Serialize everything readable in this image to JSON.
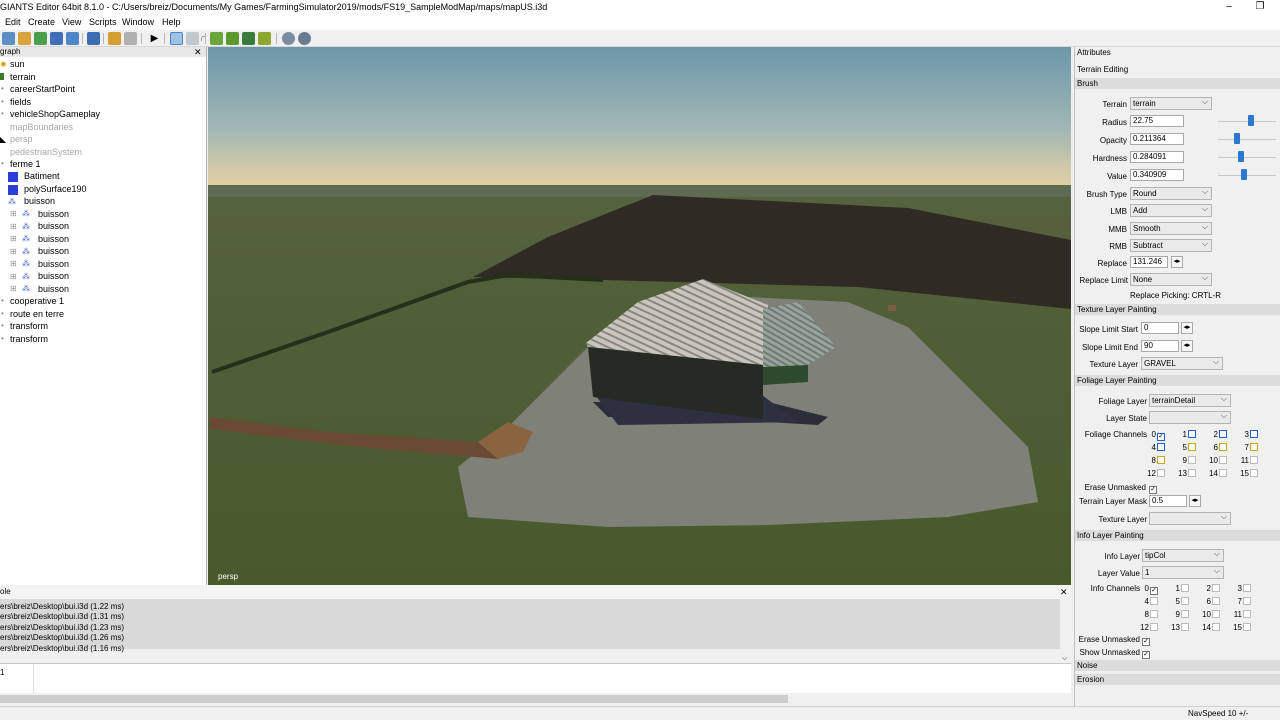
{
  "window": {
    "title": "GIANTS Editor 64bit 8.1.0 - C:/Users/breiz/Documents/My Games/FarmingSimulator2019/mods/FS19_SampleModMap/maps/mapUS.i3d",
    "minimize": "–",
    "maximize": "❐"
  },
  "menu": [
    "Edit",
    "Create",
    "View",
    "Scripts",
    "Window",
    "Help"
  ],
  "scenegraph": {
    "title": "graph",
    "nodes": [
      {
        "label": "sun"
      },
      {
        "label": "terrain"
      },
      {
        "label": "careerStartPoint"
      },
      {
        "label": "fields"
      },
      {
        "label": "vehicleShopGameplay"
      },
      {
        "label": "mapBoundaries"
      },
      {
        "label": "persp"
      },
      {
        "label": "pedestrianSystem"
      },
      {
        "label": "ferme 1"
      },
      {
        "label": "Batiment"
      },
      {
        "label": "polySurface190"
      },
      {
        "label": "buisson"
      },
      {
        "label": "buisson"
      },
      {
        "label": "buisson"
      },
      {
        "label": "buisson"
      },
      {
        "label": "buisson"
      },
      {
        "label": "buisson"
      },
      {
        "label": "buisson"
      },
      {
        "label": "buisson"
      },
      {
        "label": "cooperative 1"
      },
      {
        "label": "route en terre"
      },
      {
        "label": "transform"
      },
      {
        "label": "transform"
      }
    ]
  },
  "viewport": {
    "camera_label": "persp"
  },
  "console": {
    "title": "ole",
    "lines": [
      "ers\\breiz\\Desktop\\bui.i3d (1.22 ms)",
      "ers\\breiz\\Desktop\\bui.i3d (1.31 ms)",
      "ers\\breiz\\Desktop\\bui.i3d (1.23 ms)",
      "ers\\breiz\\Desktop\\bui.i3d (1.26 ms)",
      "ers\\breiz\\Desktop\\bui.i3d (1.16 ms)"
    ],
    "prompt": "1"
  },
  "attributes": {
    "title": "Attributes",
    "subtitle": "Terrain Editing",
    "brush": {
      "header": "Brush",
      "terrain_label": "Terrain",
      "terrain_value": "terrain",
      "radius_label": "Radius",
      "radius_value": "22.75",
      "radius_level": 0.55,
      "opacity_label": "Opacity",
      "opacity_value": "0.211364",
      "opacity_level": 0.21,
      "hardness_label": "Hardness",
      "hardness_value": "0.284091",
      "hardness_level": 0.28,
      "value_label": "Value",
      "value_value": "0.340909",
      "value_level": 0.34,
      "brush_type_label": "Brush Type",
      "brush_type_value": "Round",
      "lmb_label": "LMB",
      "lmb_value": "Add",
      "mmb_label": "MMB",
      "mmb_value": "Smooth",
      "rmb_label": "RMB",
      "rmb_value": "Subtract",
      "replace_label": "Replace",
      "replace_value": "131.246",
      "replace_limit_label": "Replace Limit",
      "replace_limit_value": "None",
      "replace_picking": "Replace Picking: CRTL-R"
    },
    "texture": {
      "header": "Texture Layer Painting",
      "slope_start_label": "Slope Limit Start",
      "slope_start_value": "0",
      "slope_end_label": "Slope Limit End",
      "slope_end_value": "90",
      "layer_label": "Texture Layer",
      "layer_value": "GRAVEL"
    },
    "foliage": {
      "header": "Foliage Layer Painting",
      "layer_label": "Foliage Layer",
      "layer_value": "terrainDetail",
      "state_label": "Layer State",
      "state_value": "",
      "channels_label": "Foliage Channels",
      "channels": [
        "0",
        "1",
        "2",
        "3",
        "4",
        "5",
        "6",
        "7",
        "8",
        "9",
        "10",
        "11",
        "12",
        "13",
        "14",
        "15"
      ],
      "erase_label": "Erase Unmasked",
      "mask_label": "Terrain Layer Mask",
      "mask_value": "0.5",
      "texlayer_label": "Texture Layer",
      "texlayer_value": ""
    },
    "info": {
      "header": "Info Layer Painting",
      "layer_label": "Info Layer",
      "layer_value": "tipCol",
      "value_label": "Layer Value",
      "value_value": "1",
      "channels_label": "Info Channels",
      "channels": [
        "0",
        "1",
        "2",
        "3",
        "4",
        "5",
        "6",
        "7",
        "8",
        "9",
        "10",
        "11",
        "12",
        "13",
        "14",
        "15"
      ],
      "erase_label": "Erase Unmasked",
      "show_label": "Show Unmasked"
    },
    "noise_header": "Noise",
    "erosion_header": "Erosion"
  },
  "status": {
    "navspeed": "NavSpeed 10 +/-"
  },
  "colors": {
    "slider_thumb": "#2b78d0",
    "foliage_blue": "#1f5fd0",
    "foliage_yellow": "#c8a800",
    "sky_top": "#6a96a8",
    "grass": "#4e5f34"
  }
}
